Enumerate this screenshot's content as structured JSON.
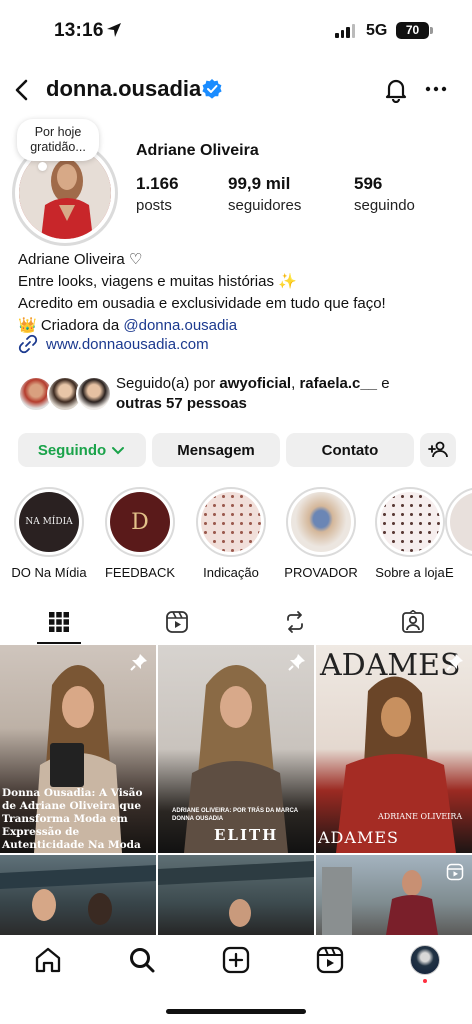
{
  "status_bar": {
    "time": "13:16",
    "network": "5G",
    "battery": "70"
  },
  "header": {
    "username": "donna.ousadia"
  },
  "note": {
    "text": "Por hoje gratidão..."
  },
  "profile": {
    "display_name": "Adriane Oliveira",
    "stats": [
      {
        "value": "1.166",
        "label": "posts"
      },
      {
        "value": "99,9 mil",
        "label": "seguidores"
      },
      {
        "value": "596",
        "label": "seguindo"
      }
    ]
  },
  "bio": {
    "line1": "Adriane Oliveira ♡",
    "line2": "Entre looks, viagens e muitas histórias ✨",
    "line3": "Acredito em ousadia e exclusividade em tudo que faço!",
    "line4_prefix": "👑 Criadora da ",
    "line4_mention": "@donna.ousadia",
    "link": "www.donnaousadia.com"
  },
  "followed_by": {
    "prefix": "Seguido(a) por ",
    "user1": "awyoficial",
    "separator": ", ",
    "user2": "rafaela.c__",
    "conj": " e",
    "others": "outras 57 pessoas"
  },
  "buttons": {
    "following": "Seguindo",
    "message": "Mensagem",
    "contact": "Contato"
  },
  "highlights": [
    {
      "label": "DO Na Mídia",
      "inner_text": "NA MÍDIA"
    },
    {
      "label": "FEEDBACK",
      "inner_text": "D"
    },
    {
      "label": "Indicação"
    },
    {
      "label": "PROVADOR"
    },
    {
      "label": "Sobre a loja"
    },
    {
      "label": "E"
    }
  ],
  "posts": [
    {
      "caption": "Donna Ousadia: A Visão de Adriane Oliveira que Transforma Moda em Expressão de Autenticidade Na Moda Brasileira",
      "pinned": true
    },
    {
      "caption": "ADRIANE OLIVEIRA: POR TRÁS DA MARCA DONNA OUSADIA",
      "brand": "ELITH",
      "pinned": true
    },
    {
      "caption": "ADRIANE OLIVEIRA",
      "brand": "ADAMES",
      "pinned": true
    }
  ],
  "colors": {
    "following": "#1aa34a",
    "link": "#1c3a8f",
    "verified": "#1a8cff"
  }
}
